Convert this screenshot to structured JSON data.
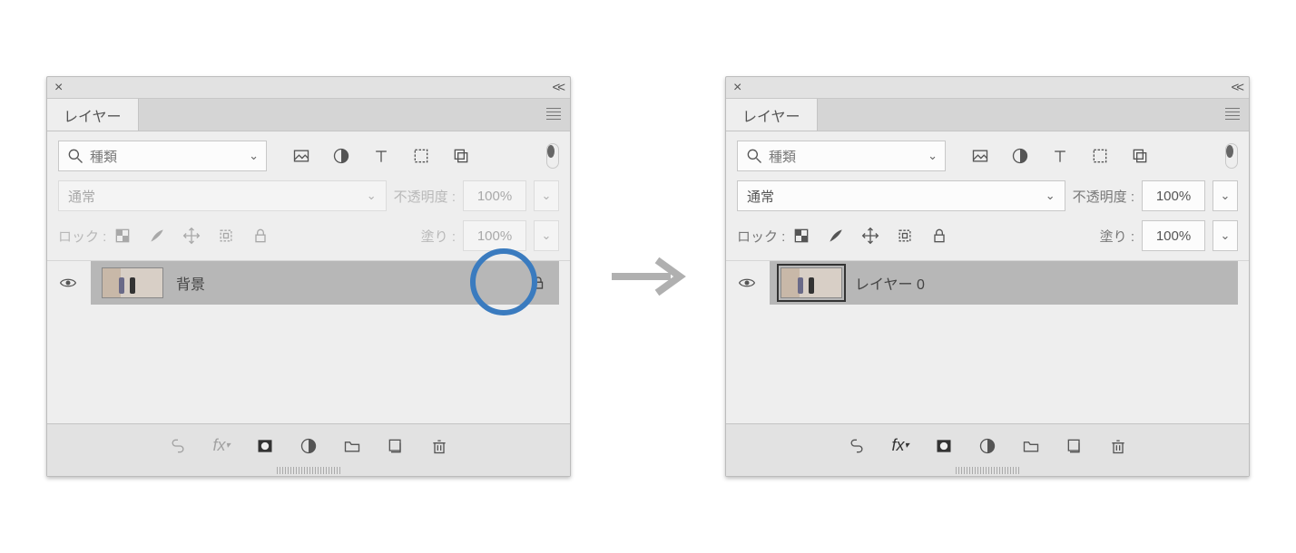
{
  "left_panel": {
    "tab_label": "レイヤー",
    "search_placeholder": "種類",
    "blend_mode": "通常",
    "opacity_label": "不透明度 :",
    "opacity_value": "100%",
    "lock_label": "ロック :",
    "fill_label": "塗り :",
    "fill_value": "100%",
    "controls_disabled": true,
    "layer": {
      "name": "背景",
      "locked": true,
      "selected": true,
      "thumb_framed": false
    }
  },
  "right_panel": {
    "tab_label": "レイヤー",
    "search_placeholder": "種類",
    "blend_mode": "通常",
    "opacity_label": "不透明度 :",
    "opacity_value": "100%",
    "lock_label": "ロック :",
    "fill_label": "塗り :",
    "fill_value": "100%",
    "controls_disabled": false,
    "layer": {
      "name": "レイヤー 0",
      "locked": false,
      "selected": true,
      "thumb_framed": true
    }
  }
}
